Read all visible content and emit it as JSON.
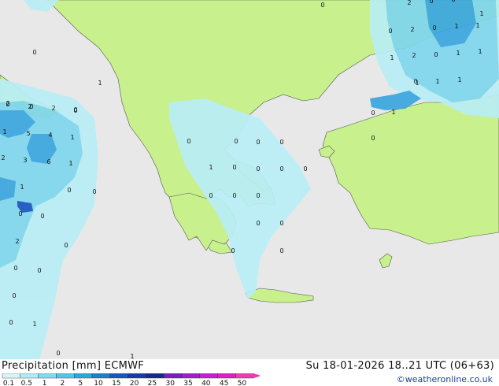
{
  "header": {
    "title_left": "Precipitation [mm]  ECMWF",
    "title_right": "Su 18-01-2026 18..21 UTC (06+63)"
  },
  "credit": "©weatheronline.co.uk",
  "legend": {
    "ticks": [
      "0.1",
      "0.5",
      "1",
      "2",
      "5",
      "10",
      "15",
      "20",
      "25",
      "30",
      "35",
      "40",
      "45",
      "50"
    ],
    "colors": [
      "#d7f5f9",
      "#b0ecf5",
      "#7fdcee",
      "#4fc8e6",
      "#27a9dc",
      "#1a7fcf",
      "#1a55c0",
      "#183aa8",
      "#152a8c",
      "#7a1fc0",
      "#a21dcc",
      "#c91dd6",
      "#e01ec8",
      "#f03ab5"
    ]
  },
  "map": {
    "land_color": "#c8f08c",
    "sea_color": "#e8e8e8",
    "precip_light": "#b9eef6",
    "precip_mid": "#7fd6ee",
    "precip_heavy": "#3aa6e0",
    "labels": [
      {
        "t": "0"
      },
      {
        "t": "2"
      },
      {
        "t": "0"
      },
      {
        "t": "0"
      },
      {
        "t": "1"
      },
      {
        "t": "0"
      },
      {
        "t": "2"
      },
      {
        "t": "0"
      },
      {
        "t": "1"
      },
      {
        "t": "1"
      },
      {
        "t": "1"
      },
      {
        "t": "2"
      },
      {
        "t": "0"
      },
      {
        "t": "1"
      },
      {
        "t": "1"
      },
      {
        "t": "0"
      },
      {
        "t": "1"
      },
      {
        "t": "1"
      },
      {
        "t": "1"
      },
      {
        "t": "0"
      },
      {
        "t": "1"
      },
      {
        "t": "0"
      },
      {
        "t": "1"
      },
      {
        "t": "0"
      },
      {
        "t": "0"
      },
      {
        "t": "0"
      },
      {
        "t": "2"
      },
      {
        "t": "2"
      },
      {
        "t": "2"
      },
      {
        "t": "0"
      },
      {
        "t": "1"
      },
      {
        "t": "5"
      },
      {
        "t": "4"
      },
      {
        "t": "1"
      },
      {
        "t": "2"
      },
      {
        "t": "3"
      },
      {
        "t": "6"
      },
      {
        "t": "1"
      },
      {
        "t": "1"
      },
      {
        "t": "0"
      },
      {
        "t": "0"
      },
      {
        "t": "0"
      },
      {
        "t": "0"
      },
      {
        "t": "2"
      },
      {
        "t": "0"
      },
      {
        "t": "0"
      },
      {
        "t": "0"
      },
      {
        "t": "0"
      },
      {
        "t": "0"
      },
      {
        "t": "1"
      },
      {
        "t": "0"
      },
      {
        "t": "1"
      },
      {
        "t": "0"
      },
      {
        "t": "0"
      },
      {
        "t": "0"
      },
      {
        "t": "1"
      },
      {
        "t": "0"
      },
      {
        "t": "0"
      },
      {
        "t": "0"
      },
      {
        "t": "0"
      },
      {
        "t": "0"
      },
      {
        "t": "0"
      },
      {
        "t": "0"
      },
      {
        "t": "0"
      },
      {
        "t": "0"
      },
      {
        "t": "0"
      },
      {
        "t": "0"
      },
      {
        "t": "0"
      },
      {
        "t": "0"
      }
    ]
  }
}
